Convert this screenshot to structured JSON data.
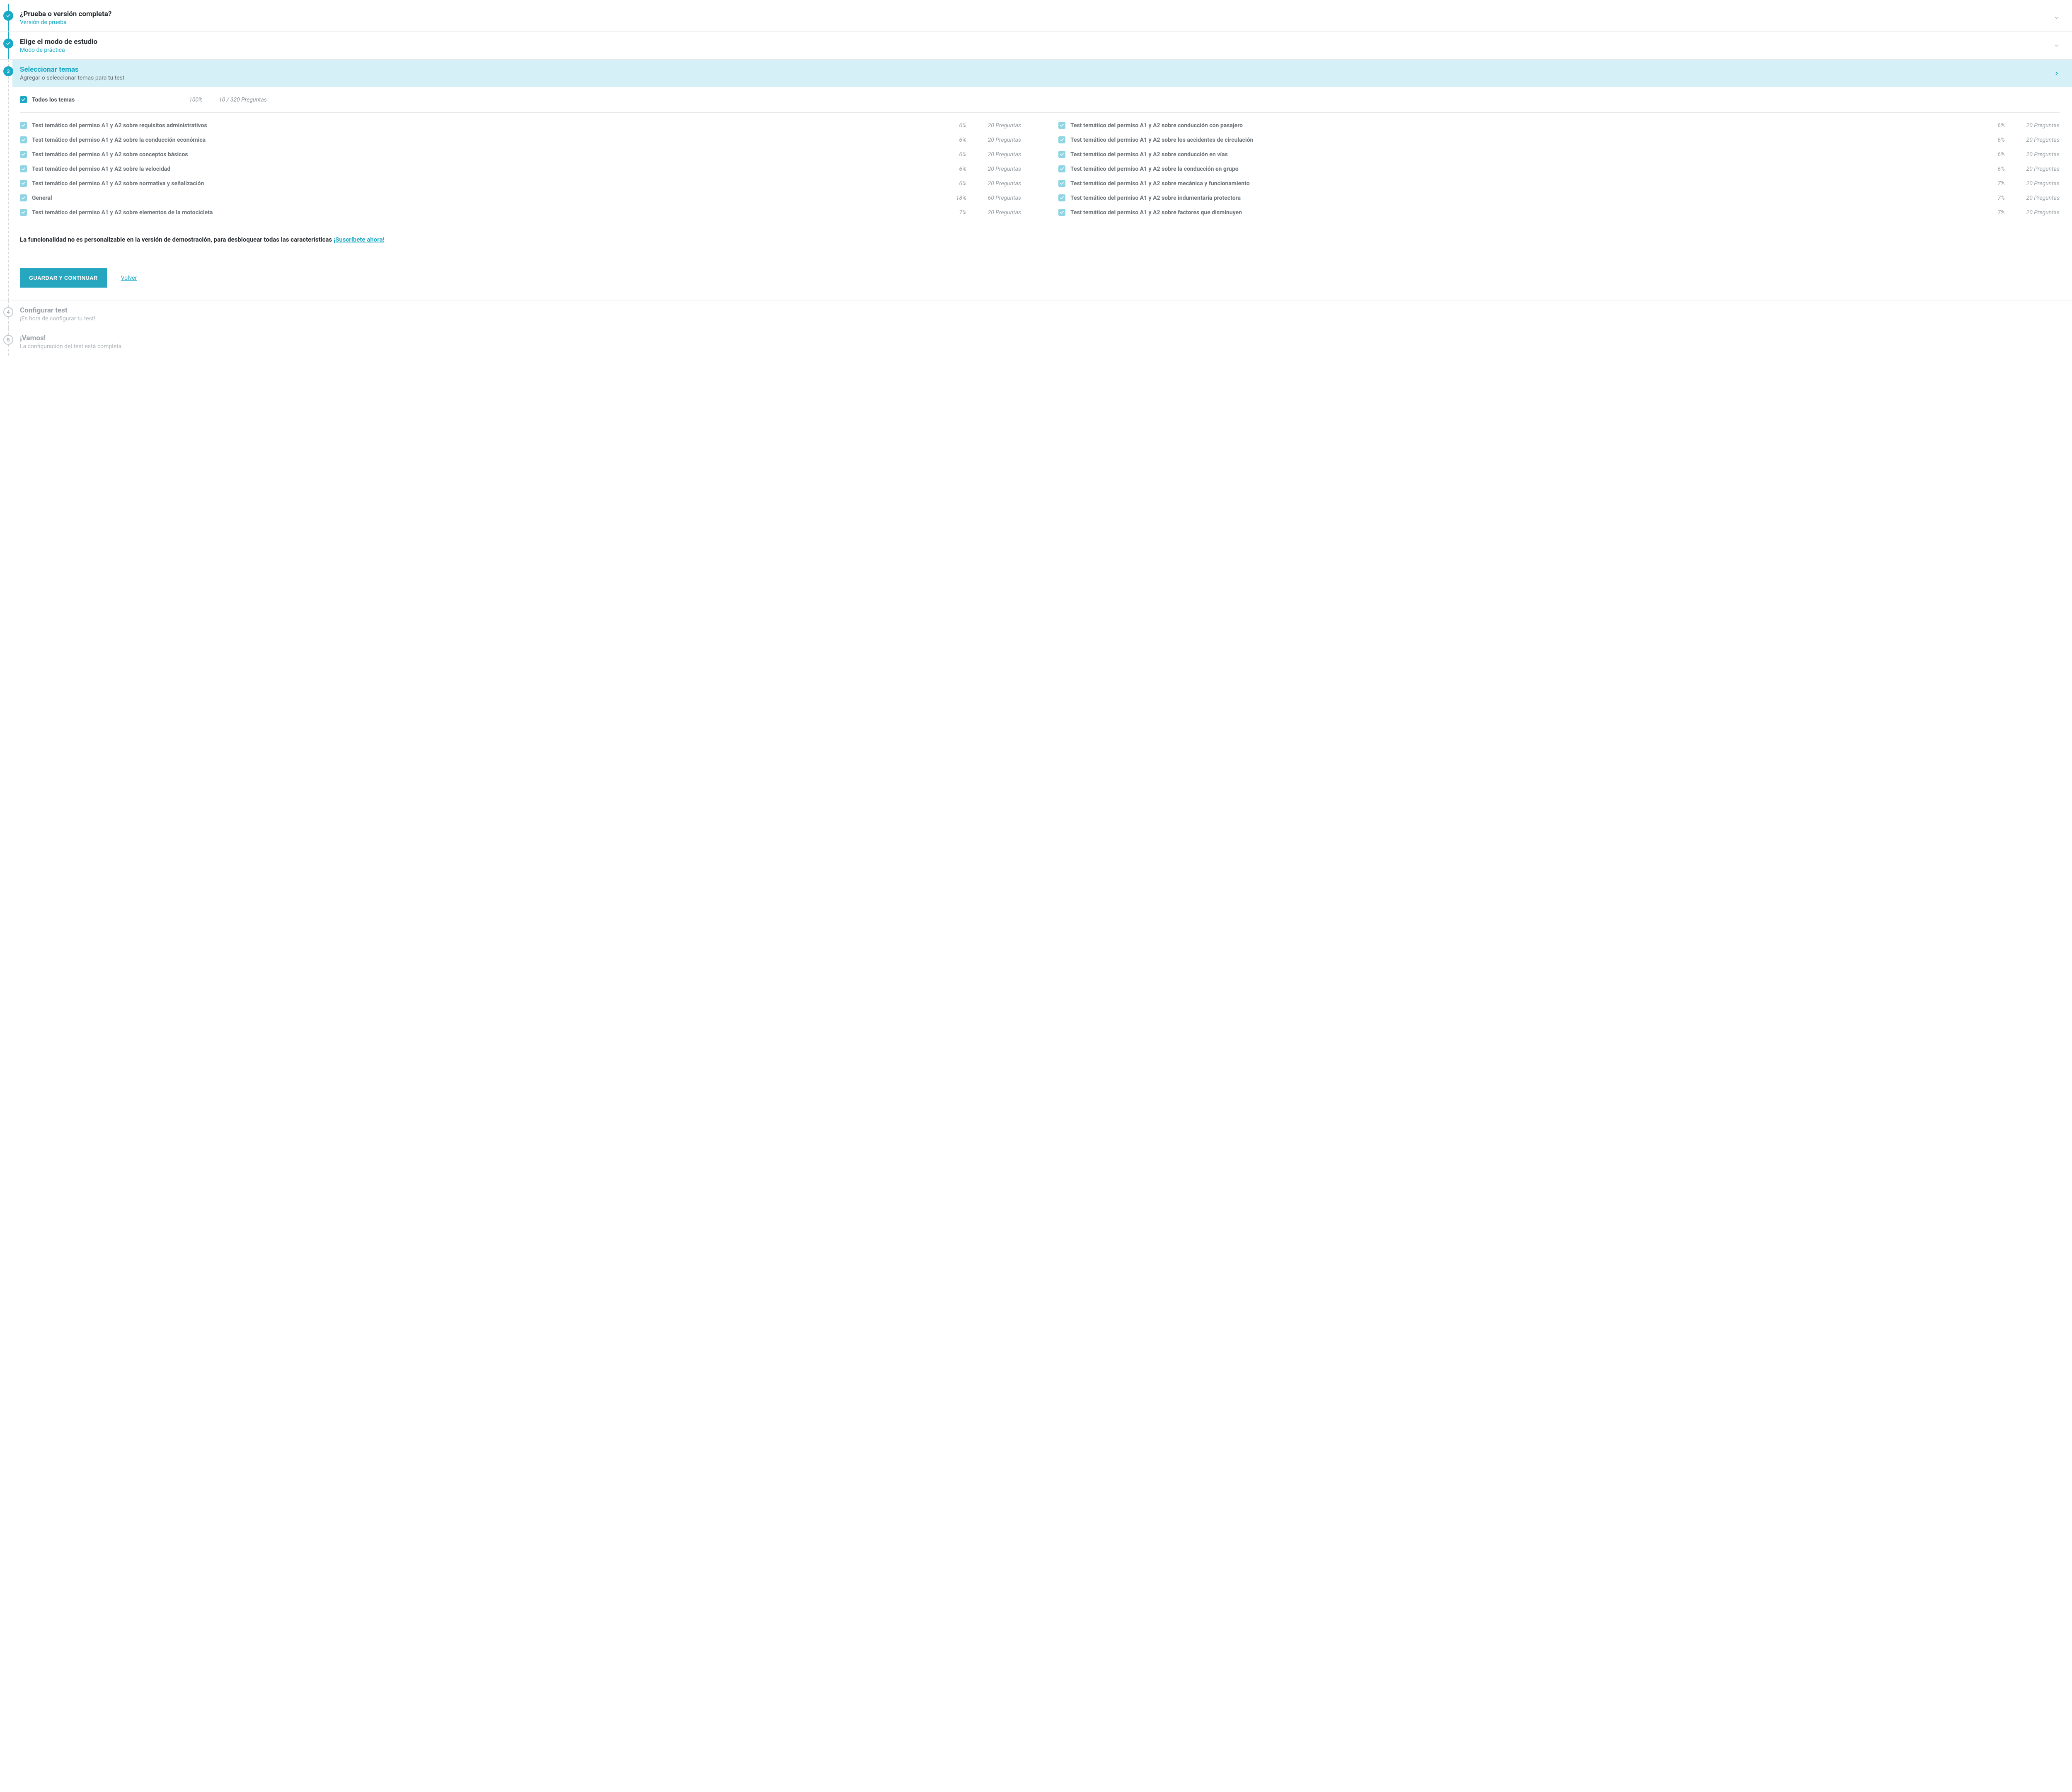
{
  "steps": {
    "s1": {
      "title": "¿Prueba o versión completa?",
      "sub": "Versión de prueba"
    },
    "s2": {
      "title": "Elige el modo de estudio",
      "sub": "Modo de práctica"
    },
    "s3": {
      "title": "Seleccionar temas",
      "sub": "Agregar o seleccionar temas para tu test"
    },
    "s4": {
      "title": "Configurar test",
      "sub": "¡Es hora de configurar tu test!"
    },
    "s5": {
      "title": "¡Vamos!",
      "sub": "La configuración del test está completa"
    },
    "badge3": "3",
    "badge4": "4",
    "badge5": "5"
  },
  "all": {
    "label": "Todos los temas",
    "pct": "100%",
    "q": "10 / 320 Preguntas"
  },
  "topics_left": [
    {
      "label": "Test temático del permiso A1 y A2 sobre requisitos administrativos",
      "pct": "6%",
      "q": "20 Preguntas"
    },
    {
      "label": "Test temático del permiso A1 y A2 sobre la conducción económica",
      "pct": "6%",
      "q": "20 Preguntas"
    },
    {
      "label": "Test temático del permiso A1 y A2 sobre conceptos básicos",
      "pct": "6%",
      "q": "20 Preguntas"
    },
    {
      "label": "Test temático del permiso A1 y A2 sobre la velocidad",
      "pct": "6%",
      "q": "20 Preguntas"
    },
    {
      "label": "Test temático del permiso A1 y A2 sobre normativa y señalización",
      "pct": "6%",
      "q": "20 Preguntas"
    },
    {
      "label": "General",
      "pct": "18%",
      "q": "60 Preguntas"
    },
    {
      "label": "Test temático del permiso A1 y A2 sobre elementos de la motocicleta",
      "pct": "7%",
      "q": "20 Preguntas"
    }
  ],
  "topics_right": [
    {
      "label": "Test temático del permiso A1 y A2 sobre conducción con pasajero",
      "pct": "6%",
      "q": "20 Preguntas"
    },
    {
      "label": "Test temático del permiso A1 y A2 sobre los accidentes de circulación",
      "pct": "6%",
      "q": "20 Preguntas"
    },
    {
      "label": "Test temático del permiso A1 y A2 sobre conducción en vías",
      "pct": "6%",
      "q": "20 Preguntas"
    },
    {
      "label": "Test temático del permiso A1 y A2 sobre la conducción en grupo",
      "pct": "6%",
      "q": "20 Preguntas"
    },
    {
      "label": "Test temático del permiso A1 y A2 sobre mecánica y funcionamiento",
      "pct": "7%",
      "q": "20 Preguntas"
    },
    {
      "label": "Test temático del permiso A1 y A2 sobre indumentaria protectora",
      "pct": "7%",
      "q": "20 Preguntas"
    },
    {
      "label": "Test temático del permiso A1 y A2 sobre factores que disminuyen",
      "pct": "7%",
      "q": "20 Preguntas"
    }
  ],
  "notice": {
    "text": "La funcionalidad no es personalizable en la versión de demostración, para desbloquear todas las características ",
    "link": "¡Suscríbete ahora!"
  },
  "actions": {
    "save": "GUARDAR Y CONTINUAR",
    "back": "Volver"
  }
}
